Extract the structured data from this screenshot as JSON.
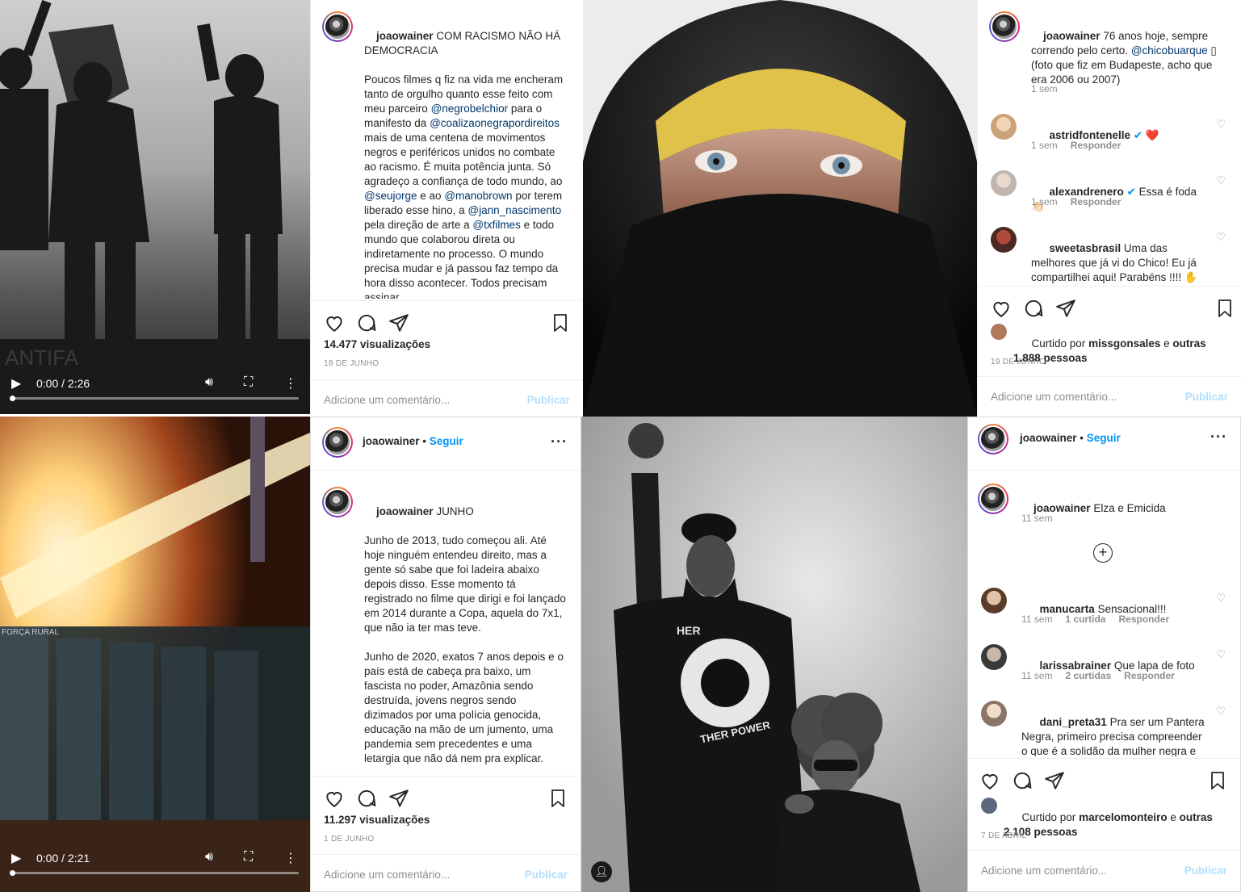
{
  "colors": {
    "link": "#00376b",
    "follow": "#0095f6",
    "publish": "#b2dffc",
    "muted": "#8e8e8e"
  },
  "post1": {
    "username": "joaowainer",
    "caption_title": "COM RACISMO NÃO HÁ DEMOCRACIA",
    "body_1": "Poucos filmes q fiz na vida me encheram tanto de orgulho quanto esse feito com meu parceiro",
    "mention_1": "@negrobelchior",
    "body_2": "para o manifesto da",
    "mention_2": "@coalizaonegrapordireitos",
    "body_3": "mais de uma centena de movimentos negros e periféricos unidos no combate ao racismo. É muita potência junta. Só agradeço a confiança de todo mundo, ao",
    "mention_3": "@seujorge",
    "body_4": "e ao",
    "mention_4": "@manobrown",
    "body_5": "por terem liberado esse hino, a",
    "mention_5": "@jann_nascimento",
    "body_6": "pela direção de arte a",
    "mention_6": "@txfilmes",
    "body_7": "e todo mundo que colaborou direta ou indiretamente no processo. O mundo precisa mudar e já passou faz tempo da hora disso acontecer. Todos precisam assinar",
    "views": "14.477 visualizações",
    "date": "18 DE JUNHO",
    "comment_placeholder": "Adicione um comentário...",
    "publish": "Publicar",
    "video": {
      "time": "0:00 / 2:26",
      "progress": 0.0,
      "watermark": "ANTIFA"
    },
    "icons": [
      "heart-icon",
      "comment-icon",
      "share-icon",
      "bookmark-icon",
      "play-icon",
      "volume-icon",
      "fullscreen-icon",
      "more-vertical-icon"
    ]
  },
  "post2": {
    "username": "joaowainer",
    "caption": "76 anos hoje, sempre correndo pelo certo.",
    "mention": "@chicobuarque",
    "caption_2": "▯ (foto que fiz em Budapeste, acho que era 2006 ou 2007)",
    "time": "1 sem",
    "comments": [
      {
        "user": "astridfontenelle",
        "text": "❤️",
        "time": "1 sem",
        "reply": "Responder",
        "verified": true
      },
      {
        "user": "alexandrenero",
        "text": "Essa é foda👏🏻",
        "time": "1 sem",
        "reply": "Responder",
        "verified": true
      },
      {
        "user": "sweetasbrasil",
        "text": "Uma das melhores que já vi do Chico! Eu já compartilhei aqui! Parabéns !!!! ✋ ▯▯▯▯",
        "time": "",
        "reply": "",
        "verified": false
      }
    ],
    "liked_prefix": "Curtido por",
    "liked_user": "missgonsales",
    "liked_mid": "e",
    "liked_others": "outras 1.888 pessoas",
    "date": "19 DE JUNHO",
    "comment_placeholder": "Adicione um comentário...",
    "publish": "Publicar"
  },
  "post3": {
    "username": "joaowainer",
    "follow": "Seguir",
    "dot": "•",
    "caption_title": "JUNHO",
    "para_1": "Junho de 2013, tudo começou ali. Até hoje ninguém entendeu direito, mas a gente só sabe que foi ladeira abaixo depois disso. Esse momento tá registrado no filme que dirigi e foi lançado em 2014 durante a Copa, aquela do 7x1, que não ia ter mas teve.",
    "para_2": "Junho de 2020, exatos 7 anos depois e o país está de cabeça pra baixo, um fascista no poder, Amazônia sendo destruída, jovens negros sendo dizimados por uma polícia genocida, educação na mão de um jumento, uma pandemia sem precedentes e uma letargia que não dá nem pra explicar.",
    "views": "11.297 visualizações",
    "date": "1 DE JUNHO",
    "comment_placeholder": "Adicione um comentário...",
    "publish": "Publicar",
    "video": {
      "time": "0:00 / 2:21",
      "progress": 0.0,
      "shield_text": "FORÇA RURAL"
    }
  },
  "post4": {
    "username": "joaowainer",
    "follow": "Seguir",
    "dot": "•",
    "caption": "Elza e Emicida",
    "time": "11 sem",
    "shirt_text": "THER POWER",
    "shirt_text_top": "HER",
    "comments": [
      {
        "user": "manucarta",
        "text": "Sensacional!!!",
        "time": "11 sem",
        "likes": "1 curtida",
        "reply": "Responder"
      },
      {
        "user": "larissabrainer",
        "text": "Que lapa de foto",
        "time": "11 sem",
        "likes": "2 curtidas",
        "reply": "Responder"
      },
      {
        "user": "dani_preta31",
        "text": "Pra ser um Pantera Negra, primeiro precisa compreender o que é a solidão da mulher negra e acima de tudo.",
        "time": "",
        "likes": "",
        "reply": ""
      }
    ],
    "liked_prefix": "Curtido por",
    "liked_user": "marcelomonteiro",
    "liked_mid": "e",
    "liked_others": "outras 2.108 pessoas",
    "date": "7 DE ABRIL",
    "comment_placeholder": "Adicione um comentário...",
    "publish": "Publicar"
  }
}
